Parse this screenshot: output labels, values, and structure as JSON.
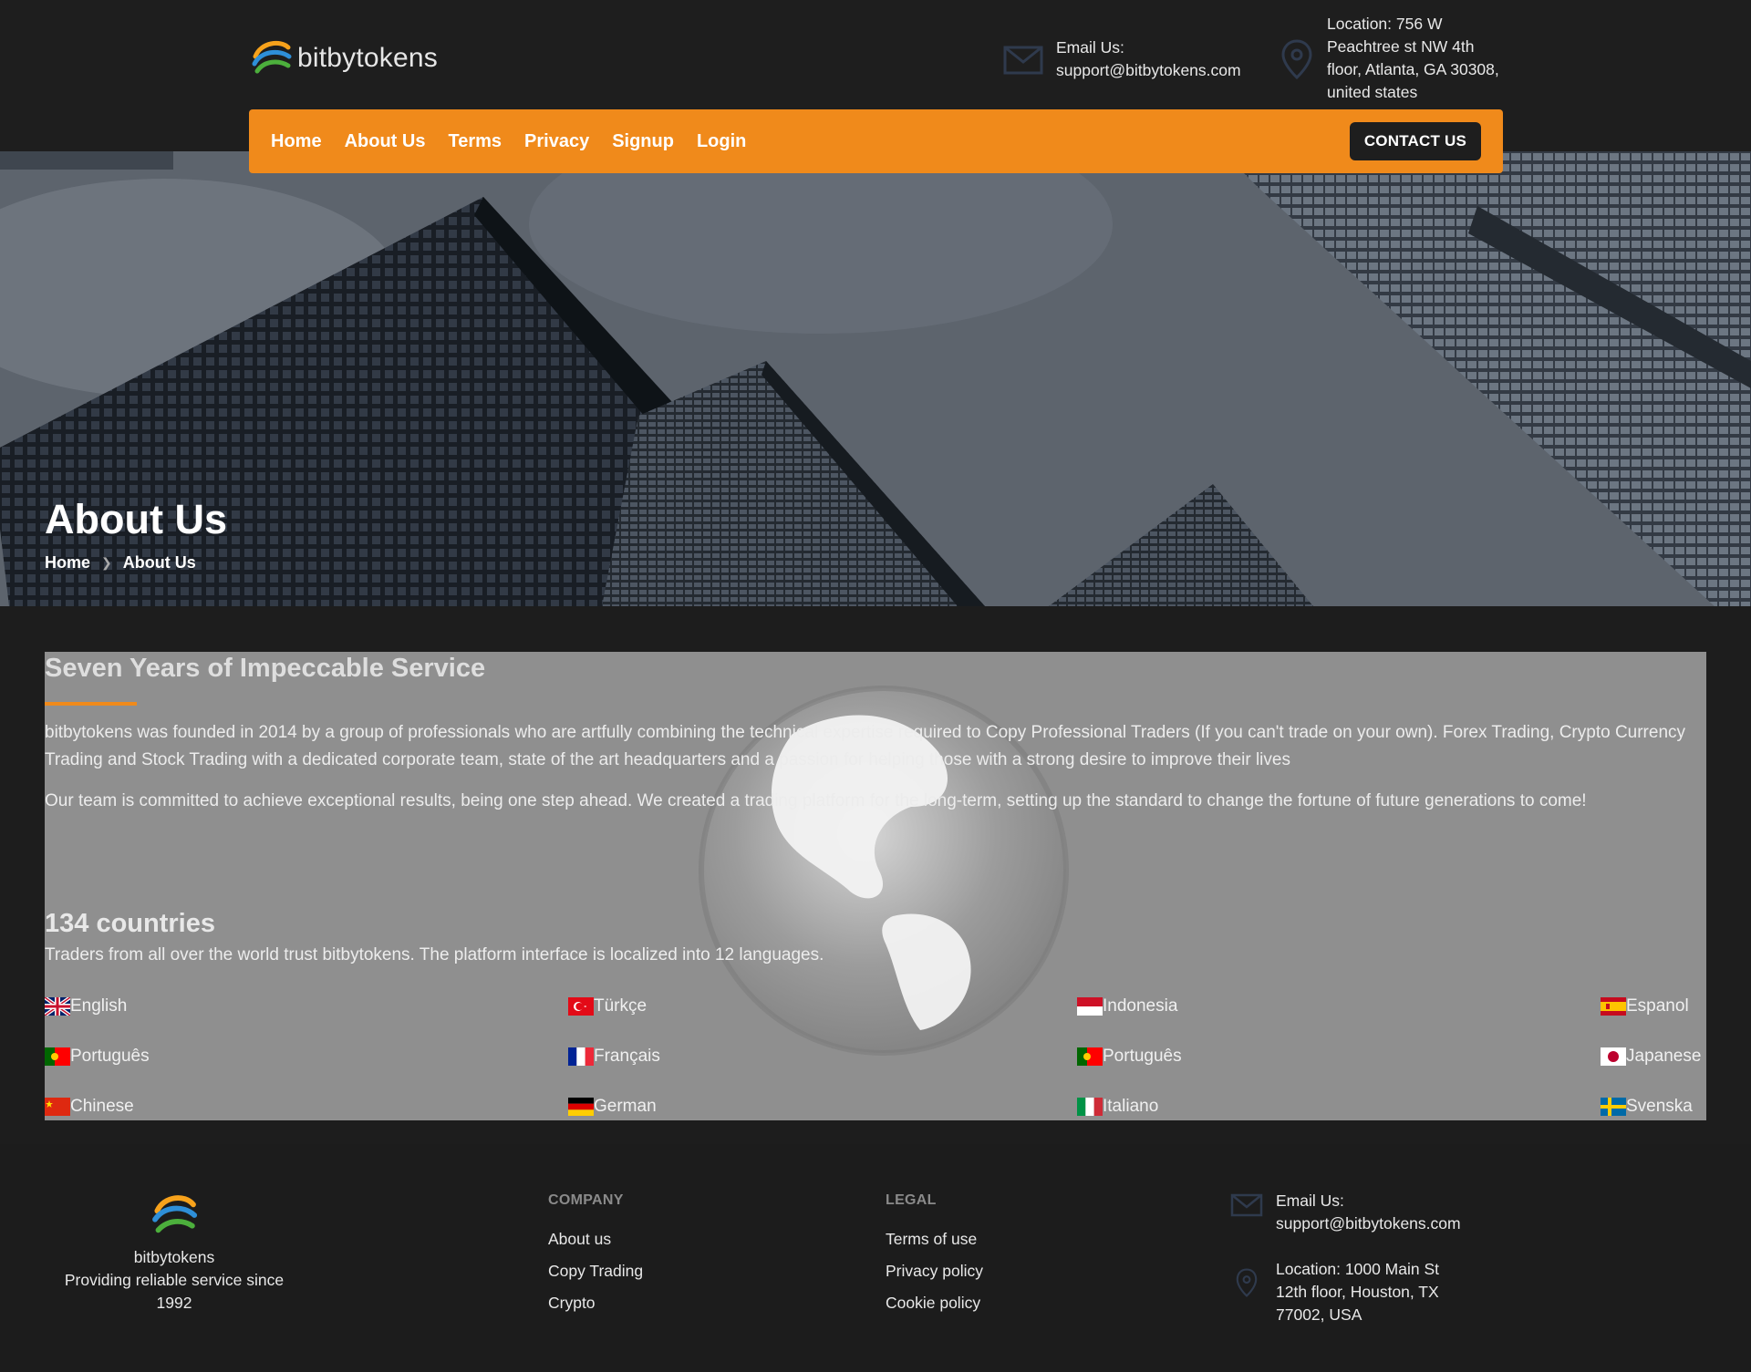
{
  "brand": {
    "name": "bitbytokens"
  },
  "header": {
    "email_label": "Email Us:",
    "email": "support@bitbytokens.com",
    "location_lines": [
      "Location: 756 W",
      "Peachtree st NW 4th",
      "floor, Atlanta, GA 30308,",
      "united states"
    ]
  },
  "nav": {
    "items": [
      "Home",
      "About Us",
      "Terms",
      "Privacy",
      "Signup",
      "Login"
    ],
    "contact_button": "CONTACT US"
  },
  "hero": {
    "title": "About Us",
    "breadcrumb": [
      "Home",
      "About Us"
    ]
  },
  "about": {
    "heading": "Seven Years of Impeccable Service",
    "paragraph1": "bitbytokens was founded in 2014 by a group of professionals who are artfully combining the technical expertise required to Copy Professional Traders (If you can't trade on your own). Forex Trading, Crypto Currency Trading and Stock Trading with a dedicated corporate team, state of the art headquarters and a passion for helping those with a strong desire to improve their lives",
    "paragraph2": "Our team is committed to achieve exceptional results, being one step ahead. We created a trading platform for the long-term, setting up the standard to change the fortune of future generations to come!",
    "countries_title": "134 countries",
    "countries_text": "Traders from all over the world trust bitbytokens. The platform interface is localized into 12 languages.",
    "languages": [
      {
        "label": "English",
        "flag": "uk-flag-icon"
      },
      {
        "label": "Türkçe",
        "flag": "turkey-flag-icon"
      },
      {
        "label": "Indonesia",
        "flag": "indonesia-flag-icon"
      },
      {
        "label": "Espanol",
        "flag": "spain-flag-icon"
      },
      {
        "label": "Português",
        "flag": "portugal-flag-icon"
      },
      {
        "label": "Français",
        "flag": "france-flag-icon"
      },
      {
        "label": "Português",
        "flag": "portugal-flag-icon"
      },
      {
        "label": "Japanese",
        "flag": "japan-flag-icon"
      },
      {
        "label": "Chinese",
        "flag": "china-flag-icon"
      },
      {
        "label": "German",
        "flag": "germany-flag-icon"
      },
      {
        "label": "Italiano",
        "flag": "italy-flag-icon"
      },
      {
        "label": "Svenska",
        "flag": "sweden-flag-icon"
      }
    ]
  },
  "footer": {
    "brand_name": "bitbytokens",
    "tagline": "Providing reliable service since 1992",
    "company": {
      "heading": "COMPANY",
      "links": [
        "About us",
        "Copy Trading",
        "Crypto"
      ]
    },
    "legal": {
      "heading": "LEGAL",
      "links": [
        "Terms of use",
        "Privacy policy",
        "Cookie policy"
      ]
    },
    "email_label": "Email Us:",
    "email": "support@bitbytokens.com",
    "location_lines": [
      "Location: 1000 Main St",
      "12th floor, Houston, TX",
      "77002, USA"
    ]
  },
  "colors": {
    "accent": "#f08a1b",
    "background": "#1d1d1d",
    "about_panel": "#8f8f8f"
  }
}
